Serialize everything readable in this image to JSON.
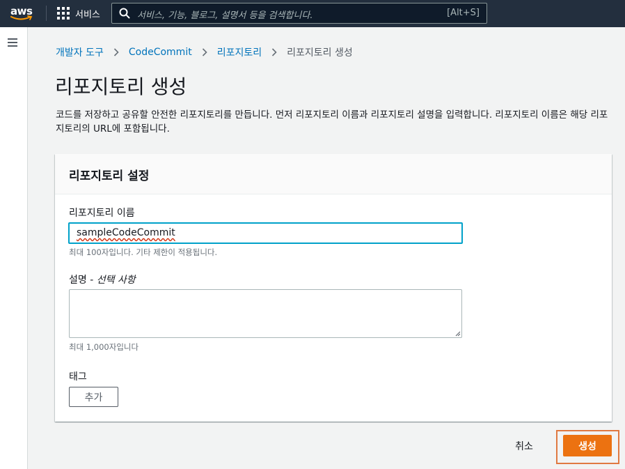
{
  "topnav": {
    "logo_text": "aws",
    "services_label": "서비스",
    "search_placeholder": "서비스, 기능, 블로그, 설명서 등을 검색합니다.",
    "search_shortcut": "[Alt+S]"
  },
  "breadcrumb": {
    "items": [
      "개발자 도구",
      "CodeCommit",
      "리포지토리"
    ],
    "current": "리포지토리 생성"
  },
  "page": {
    "title": "리포지토리 생성",
    "description": "코드를 저장하고 공유할 안전한 리포지토리를 만듭니다. 먼저 리포지토리 이름과 리포지토리 설명을 입력합니다. 리포지토리 이름은 해당 리포지토리의 URL에 포함됩니다."
  },
  "panel": {
    "title": "리포지토리 설정",
    "name_label": "리포지토리 이름",
    "name_value": "sampleCodeCommit",
    "name_hint": "최대 100자입니다. 기타 제한이 적용됩니다.",
    "desc_label": "설명",
    "desc_optional": "선택 사항",
    "desc_value": "",
    "desc_hint": "최대 1,000자입니다",
    "tags_label": "태그",
    "add_label": "추가"
  },
  "actions": {
    "cancel_label": "취소",
    "create_label": "생성"
  },
  "colors": {
    "nav_bg": "#232f3e",
    "link": "#0073bb",
    "primary": "#ec7211",
    "focus": "#00a1c9",
    "highlight": "#e07941"
  }
}
